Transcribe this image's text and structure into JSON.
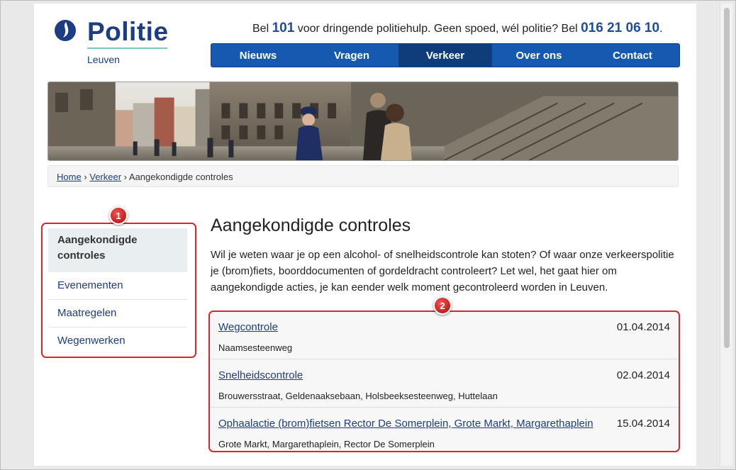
{
  "logo": {
    "name": "Politie",
    "subtitle": "Leuven"
  },
  "hotline": {
    "part1": "Bel ",
    "emergency_number": "101",
    "part2": " voor dringende politiehulp. Geen spoed, wél politie? Bel ",
    "info_number": "016 21 06 10",
    "part3": "."
  },
  "nav": {
    "items": [
      "Nieuws",
      "Vragen",
      "Verkeer",
      "Over ons",
      "Contact"
    ],
    "active": "Verkeer"
  },
  "breadcrumb": {
    "home": "Home",
    "sep": " › ",
    "section": "Verkeer",
    "current": "Aangekondigde controles"
  },
  "sidebar": {
    "items": [
      {
        "label": "Aangekondigde controles",
        "active": true
      },
      {
        "label": "Evenementen",
        "active": false
      },
      {
        "label": "Maatregelen",
        "active": false
      },
      {
        "label": "Wegenwerken",
        "active": false
      }
    ]
  },
  "annotations": [
    "1",
    "2"
  ],
  "main": {
    "title": "Aangekondigde controles",
    "intro": "Wil je weten waar je op een alcohol- of snelheidscontrole kan stoten? Of waar onze verkeerspolitie je (brom)fiets, boorddocumenten of gordeldracht controleert? Let wel, het gaat hier om aangekondigde acties, je kan eender welk moment gecontroleerd worden in Leuven.",
    "controls": [
      {
        "title": "Wegcontrole",
        "date": "01.04.2014",
        "location": "Naamsesteenweg"
      },
      {
        "title": "Snelheidscontrole",
        "date": "02.04.2014",
        "location": "Brouwersstraat, Geldenaaksebaan, Holsbeeksesteenweg, Huttelaan"
      },
      {
        "title": "Ophaalactie (brom)fietsen Rector De Somerplein, Grote Markt, Margarethaplein",
        "date": "15.04.2014",
        "location": "Grote Markt, Margarethaplein, Rector De Somerplein"
      }
    ]
  },
  "colors": {
    "brand_blue": "#1d3d82",
    "nav_blue": "#1559b0",
    "nav_active": "#0f3d7c",
    "annotation_red": "#d9262c"
  }
}
